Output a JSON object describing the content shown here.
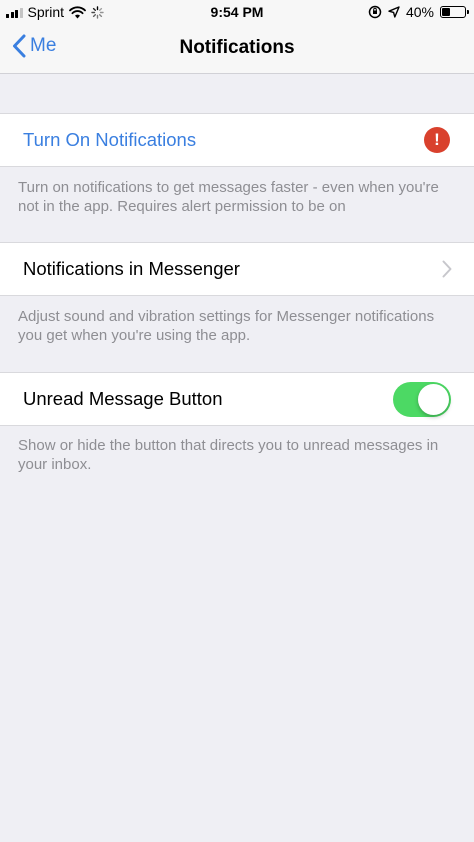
{
  "status_bar": {
    "carrier": "Sprint",
    "time": "9:54 PM",
    "battery_percent": "40%",
    "battery_level": 0.4
  },
  "nav": {
    "back_label": "Me",
    "title": "Notifications"
  },
  "sections": [
    {
      "label": "Turn On Notifications",
      "label_color": "#3a7fe0",
      "accessory": "alert-icon",
      "accessory_text": "!",
      "footer": "Turn on notifications to get messages faster - even when you're not in the app. Requires alert permission to be on"
    },
    {
      "label": "Notifications in Messenger",
      "accessory": "chevron-right-icon",
      "footer": "Adjust sound and vibration settings for Messenger notifications you get when you're using the app."
    },
    {
      "label": "Unread Message Button",
      "accessory": "toggle",
      "toggle_on": true,
      "footer": "Show or hide the button that directs you to unread messages in your inbox."
    }
  ],
  "colors": {
    "accent": "#3a7fe0",
    "alert": "#d9412d",
    "toggle_on": "#4cd964",
    "background": "#efeff4"
  }
}
